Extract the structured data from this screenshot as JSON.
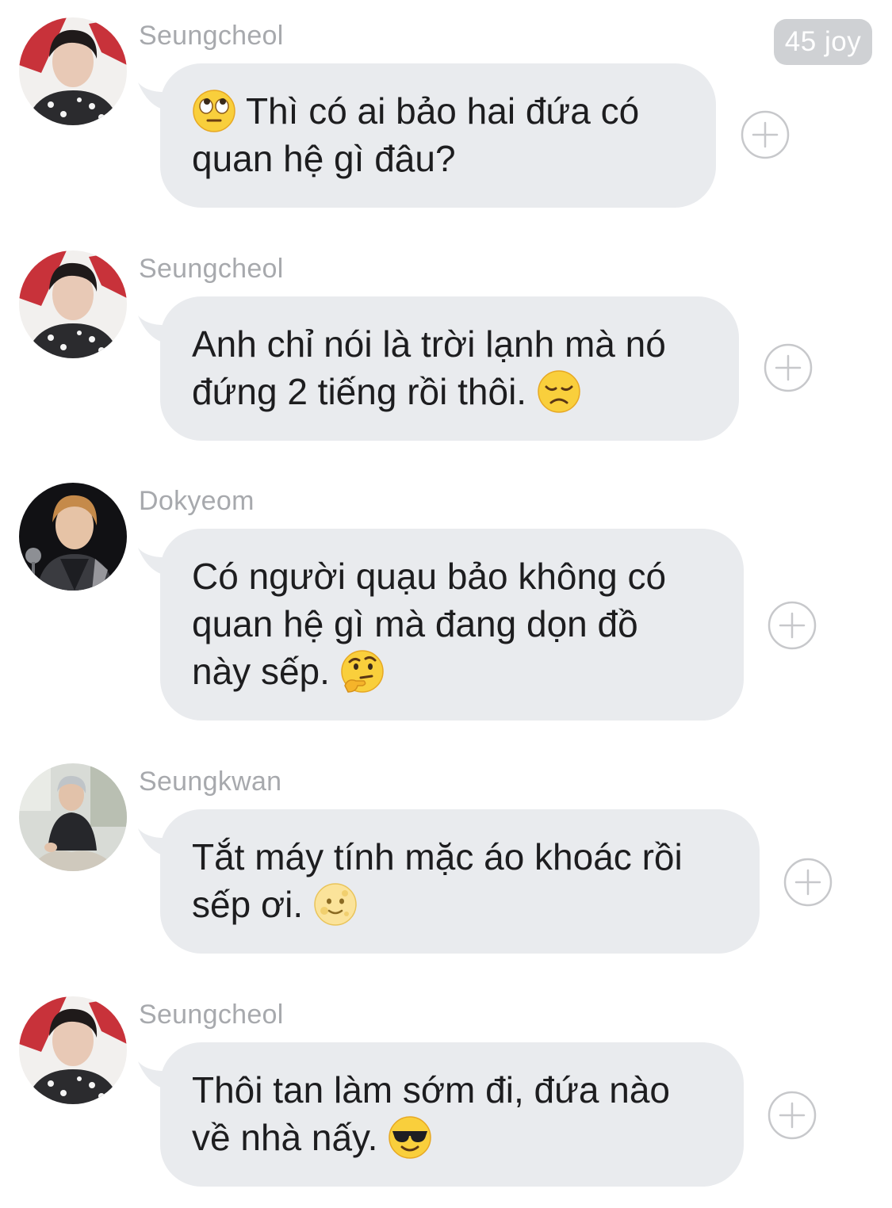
{
  "header": {
    "badge": "45 joy"
  },
  "messages": [
    {
      "sender": "Seungcheol",
      "avatar_icon": "avatar-seungcheol",
      "lines": [
        "Thì có ai bảo hai đứa có",
        "quan hệ gì đâu?"
      ],
      "emoji": "face-with-rolling-eyes-emoji"
    },
    {
      "sender": "Seungcheol",
      "avatar_icon": "avatar-seungcheol",
      "lines": [
        "Anh chỉ nói là trời lạnh mà nó",
        "đứng 2 tiếng rồi thôi."
      ],
      "emoji": "disappointed-face-emoji"
    },
    {
      "sender": "Dokyeom",
      "avatar_icon": "avatar-dokyeom",
      "lines": [
        "Có người quạu bảo không có",
        "quan hệ gì mà đang dọn đồ",
        "này sếp."
      ],
      "emoji": "thinking-face-emoji"
    },
    {
      "sender": "Seungkwan",
      "avatar_icon": "avatar-seungkwan",
      "lines": [
        "Tắt máy tính mặc áo khoác rồi",
        "sếp ơi."
      ],
      "emoji": "full-moon-face-emoji"
    },
    {
      "sender": "Seungcheol",
      "avatar_icon": "avatar-seungcheol",
      "lines": [
        "Thôi tan làm sớm đi, đứa nào",
        "về nhà nấy."
      ],
      "emoji": "smiling-face-with-sunglasses-emoji"
    }
  ],
  "reaction_icon": "add-reaction-icon",
  "colors": {
    "bubble": "#e9ebee",
    "text": "#1d1d1f",
    "sender": "#a7a9ad",
    "badge_bg": "#cfd1d4",
    "badge_text": "#ffffff",
    "add_icon": "#c7c8cb"
  }
}
